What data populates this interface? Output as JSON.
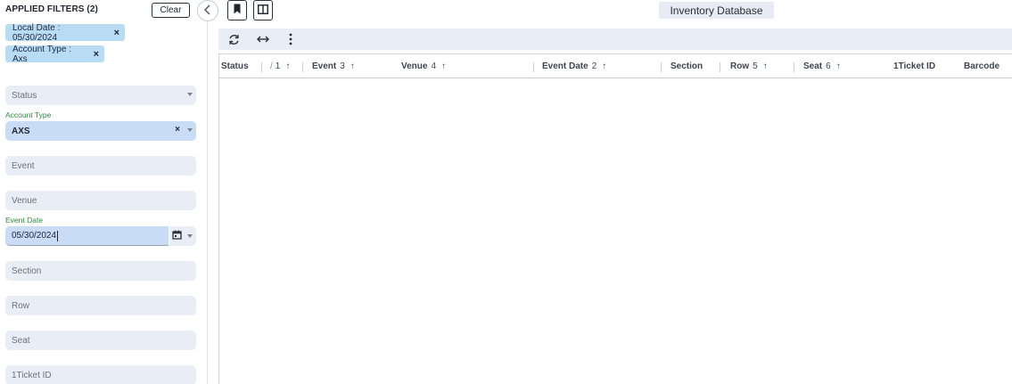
{
  "sidebar": {
    "title": "APPLIED FILTERS (2)",
    "clear_label": "Clear",
    "chips": [
      {
        "label": "Local Date : 05/30/2024",
        "remove": "×"
      },
      {
        "label": "Account Type : Axs",
        "remove": "×"
      }
    ],
    "fields": {
      "status": {
        "placeholder": "Status"
      },
      "account_type": {
        "label": "Account Type",
        "value": "AXS",
        "clear": "×"
      },
      "event": {
        "placeholder": "Event"
      },
      "venue": {
        "placeholder": "Venue"
      },
      "event_date": {
        "label": "Event Date",
        "value": "05/30/2024"
      },
      "section": {
        "placeholder": "Section"
      },
      "row": {
        "placeholder": "Row"
      },
      "seat": {
        "placeholder": "Seat"
      },
      "ticket_id": {
        "placeholder": "1Ticket ID"
      }
    }
  },
  "header": {
    "title": "Inventory Database",
    "icons": [
      "bookmark-icon",
      "columns-icon",
      "chevron-left-icon"
    ]
  },
  "toolbar": {
    "icons": [
      "refresh-icon",
      "resize-horizontal-icon",
      "more-vertical-icon"
    ]
  },
  "table": {
    "columns": [
      {
        "label": "Status",
        "sort": "",
        "arrow": ""
      },
      {
        "label": "/",
        "sort": "1",
        "arrow": "↑"
      },
      {
        "label": "Event",
        "sort": "3",
        "arrow": "↑"
      },
      {
        "label": "Venue",
        "sort": "4",
        "arrow": "↑"
      },
      {
        "label": "Event Date",
        "sort": "2",
        "arrow": "↑"
      },
      {
        "label": "Section",
        "sort": "",
        "arrow": ""
      },
      {
        "label": "Row",
        "sort": "5",
        "arrow": "↑"
      },
      {
        "label": "Seat",
        "sort": "6",
        "arrow": "↑"
      },
      {
        "label": "1Ticket ID",
        "sort": "",
        "arrow": ""
      },
      {
        "label": "Barcode",
        "sort": "",
        "arrow": ""
      }
    ],
    "rows": []
  },
  "colors": {
    "chip_bg": "#b9dcf5",
    "field_bg": "#e9eef6",
    "field_selected_bg": "#c9dcf6",
    "label_green": "#2e8b3c"
  }
}
